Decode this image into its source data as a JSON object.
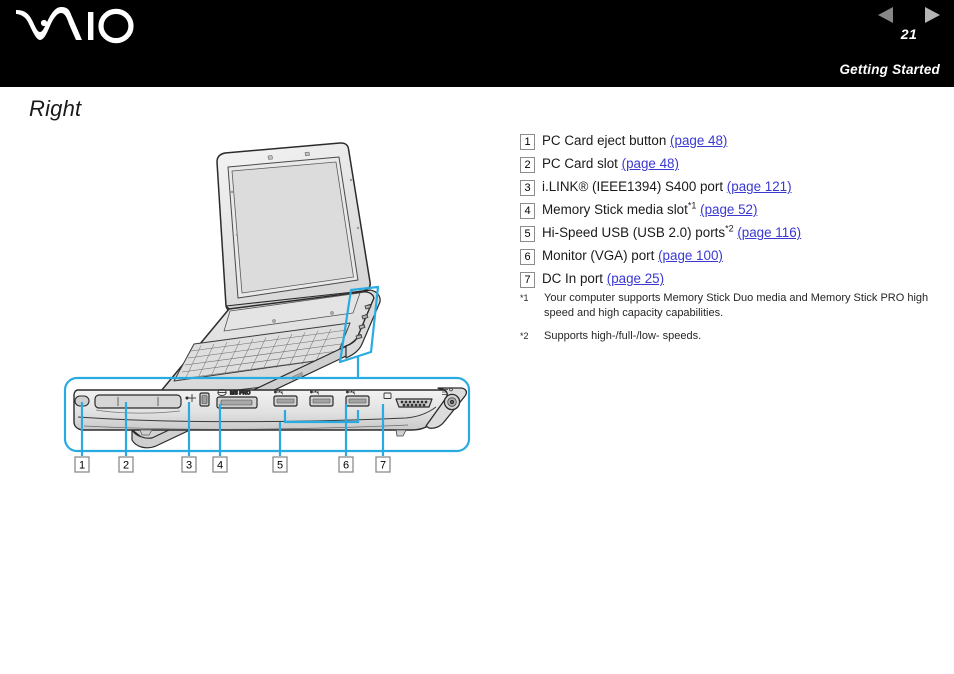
{
  "header": {
    "logo": "VAIO",
    "logo_icon": "vaio-logo",
    "prev_icon": "triangle-left-icon",
    "next_icon": "triangle-right-icon",
    "page_number": "21",
    "section": "Getting Started",
    "bar_color": "#000000"
  },
  "page": {
    "title": "Right",
    "link_color": "#3a38d1",
    "highlight_color": "#29ABE2"
  },
  "illustration": {
    "name": "laptop-right-side-diagram",
    "callout_labels": [
      "1",
      "2",
      "3",
      "4",
      "5",
      "6",
      "7"
    ],
    "port_marks": {
      "ilink": "i.LINK",
      "memory_stick": "MS PRO",
      "usb": "USB",
      "vga": "VGA",
      "dc_in": "DC IN"
    }
  },
  "specs": [
    {
      "num": "1",
      "text": "PC Card eject button ",
      "link": "(page 48)",
      "sup": ""
    },
    {
      "num": "2",
      "text": "PC Card slot ",
      "link": "(page 48)",
      "sup": ""
    },
    {
      "num": "3",
      "text": "i.LINK® (IEEE1394) S400 port ",
      "link": "(page 121)",
      "sup": ""
    },
    {
      "num": "4",
      "text": "Memory Stick media slot",
      "link": "(page 52)",
      "sup": "*1"
    },
    {
      "num": "5",
      "text": "Hi-Speed USB (USB 2.0) ports",
      "link": "(page 116)",
      "sup": "*2"
    },
    {
      "num": "6",
      "text": "Monitor (VGA) port ",
      "link": "(page 100)",
      "sup": ""
    },
    {
      "num": "7",
      "text": "DC In port ",
      "link": "(page 25)",
      "sup": ""
    }
  ],
  "footnotes": [
    {
      "marker": "*1",
      "text": "Your computer supports Memory Stick Duo media and Memory Stick PRO high speed and high capacity capabilities."
    },
    {
      "marker": "*2",
      "text": "Supports high-/full-/low- speeds."
    }
  ]
}
